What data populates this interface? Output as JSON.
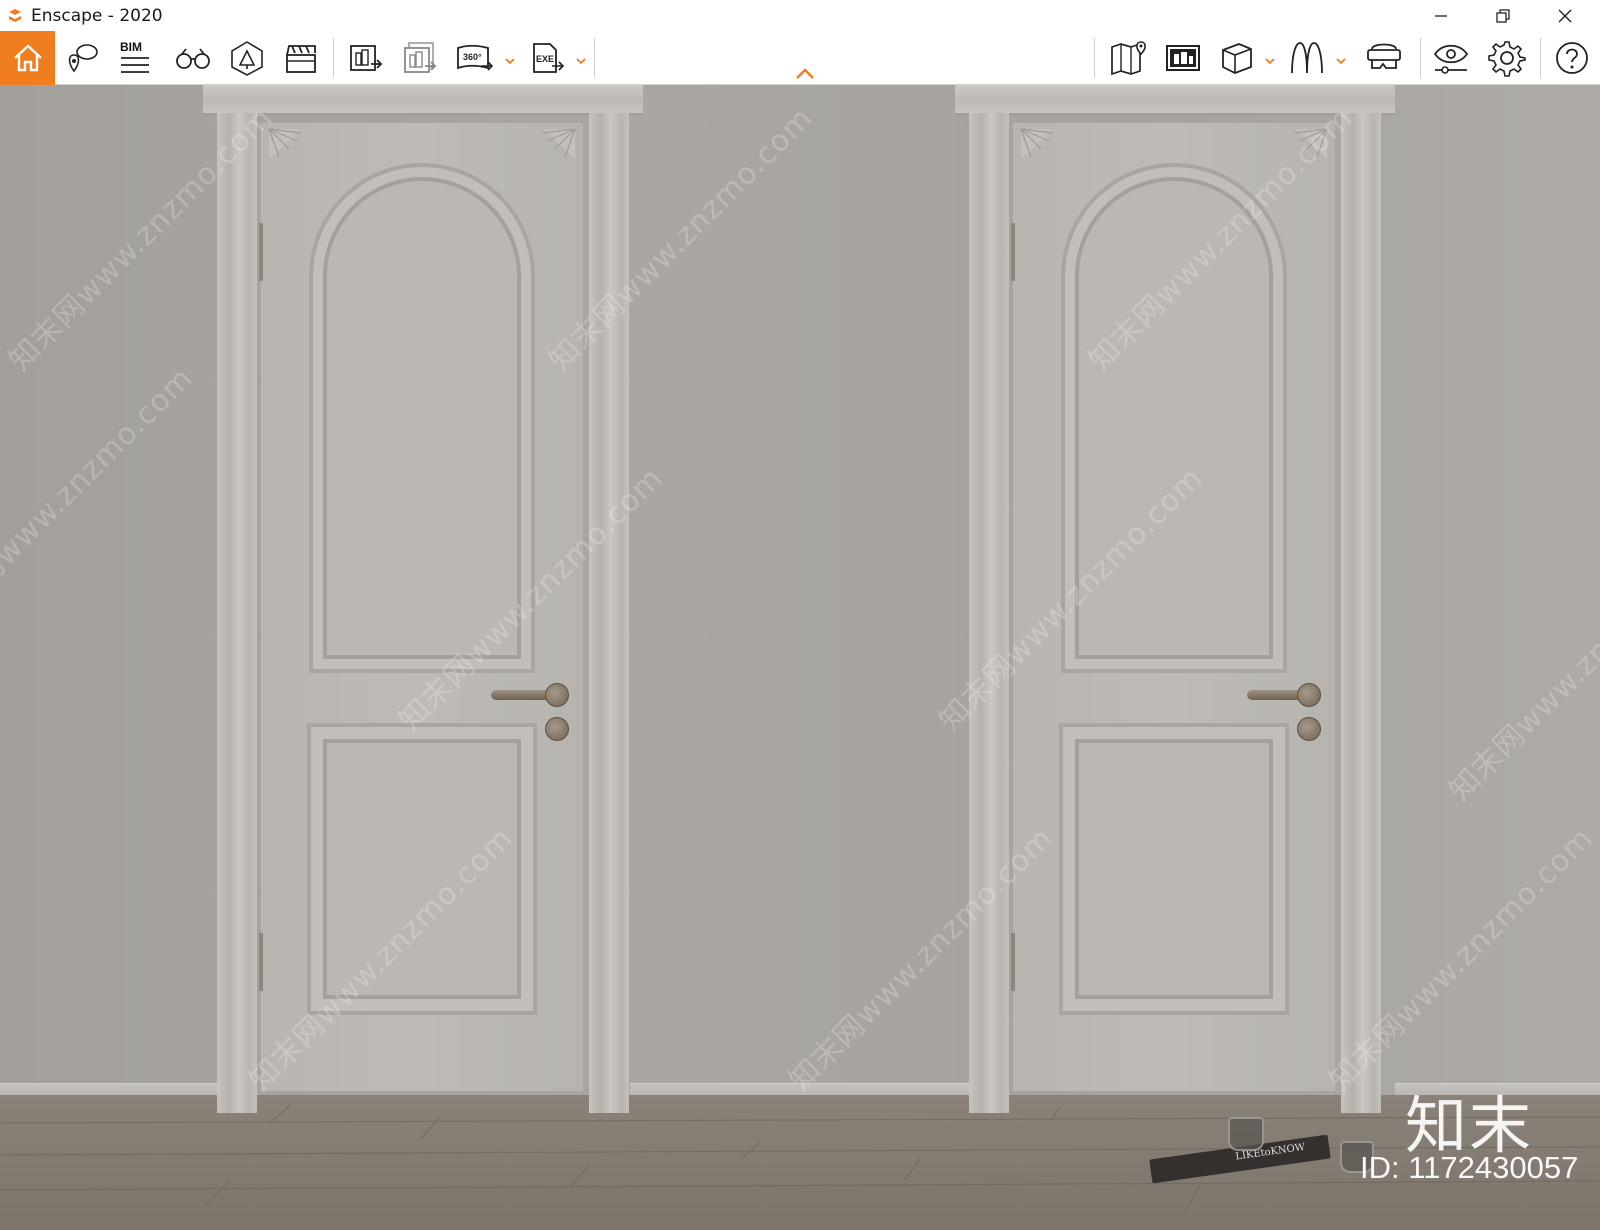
{
  "window": {
    "title": "Enscape - 2020",
    "logo_icon": "enscape-logo-icon",
    "controls": [
      "minimize-icon",
      "restore-icon",
      "close-icon"
    ]
  },
  "toolbar": {
    "accent_color": "#f07d1e",
    "left_items": [
      {
        "name": "home-button",
        "icon": "home-icon",
        "active": true
      },
      {
        "name": "views-button",
        "icon": "location-bubble-icon"
      },
      {
        "name": "bim-button",
        "icon": "bim-lines-icon",
        "label": "BIM"
      },
      {
        "name": "binoculars-button",
        "icon": "binoculars-icon"
      },
      {
        "name": "asset-library-button",
        "icon": "asset-bell-icon"
      },
      {
        "name": "video-editor-button",
        "icon": "clapperboard-icon"
      },
      {
        "name": "render-image-button",
        "icon": "render-image-icon"
      },
      {
        "name": "batch-render-button",
        "icon": "batch-render-icon"
      },
      {
        "name": "panorama-button",
        "icon": "panorama-360-icon",
        "label": "360°",
        "has_dropdown": true
      },
      {
        "name": "exe-export-button",
        "icon": "exe-export-icon",
        "label": "EXE",
        "has_dropdown": true
      }
    ],
    "collapse_icon": "chevron-up-icon",
    "right_items": [
      {
        "name": "map-button",
        "icon": "map-pin-icon"
      },
      {
        "name": "screenshot-button",
        "icon": "screenshot-icon"
      },
      {
        "name": "cube-button",
        "icon": "cube-icon",
        "has_dropdown": true
      },
      {
        "name": "walk-button",
        "icon": "walk-icon",
        "has_dropdown": true
      },
      {
        "name": "vr-headset-button",
        "icon": "vr-headset-icon"
      },
      {
        "name": "visual-settings-button",
        "icon": "eye-settings-icon"
      },
      {
        "name": "settings-button",
        "icon": "gear-icon"
      },
      {
        "name": "help-button",
        "icon": "help-icon"
      }
    ]
  },
  "viewport": {
    "watermark_text": "知末网www.znzmo.com",
    "book_spine_text": "LIKEtoKNOW",
    "brand_logo_text": "知末",
    "image_id": "ID: 1172430057"
  }
}
